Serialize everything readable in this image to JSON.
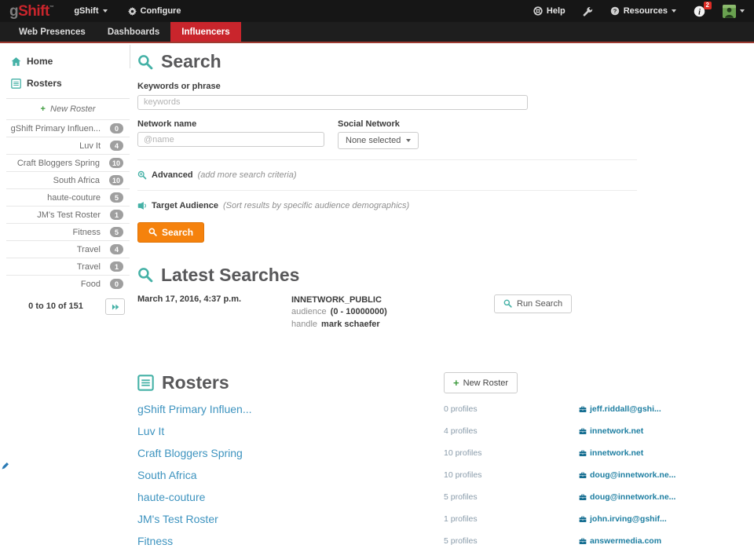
{
  "topnav": {
    "logo_g": "g",
    "logo_shift": "Shift",
    "logo_tm": "™",
    "app_menu_label": "gShift",
    "configure_label": "Configure",
    "help_label": "Help",
    "resources_label": "Resources",
    "info_badge": "2"
  },
  "tabs": [
    {
      "label": "Web Presences",
      "active": false
    },
    {
      "label": "Dashboards",
      "active": false
    },
    {
      "label": "Influencers",
      "active": true
    }
  ],
  "sidebar": {
    "home_label": "Home",
    "rosters_label": "Rosters",
    "plus": "+",
    "new_roster_label": "New Roster",
    "items": [
      {
        "label": "gShift Primary Influen...",
        "count": "0"
      },
      {
        "label": "Luv It",
        "count": "4"
      },
      {
        "label": "Craft Bloggers Spring",
        "count": "10"
      },
      {
        "label": "South Africa",
        "count": "10"
      },
      {
        "label": "haute-couture",
        "count": "5"
      },
      {
        "label": "JM's Test Roster",
        "count": "1"
      },
      {
        "label": "Fitness",
        "count": "5"
      },
      {
        "label": "Travel",
        "count": "4"
      },
      {
        "label": "Travel",
        "count": "1"
      },
      {
        "label": "Food",
        "count": "0"
      }
    ],
    "page_info": "0 to 10 of 151"
  },
  "search": {
    "title": "Search",
    "keywords_label": "Keywords or phrase",
    "keywords_placeholder": "keywords",
    "network_label": "Network name",
    "network_placeholder": "@name",
    "social_label": "Social Network",
    "social_value": "None selected",
    "advanced_label": "Advanced",
    "advanced_hint": "(add more search criteria)",
    "target_label": "Target Audience",
    "target_hint": "(Sort results by specific audience demographics)",
    "search_button": "Search"
  },
  "latest_searches": {
    "title": "Latest Searches",
    "entries": [
      {
        "date": "March 17, 2016, 4:37 p.m.",
        "name": "INNETWORK_PUBLIC",
        "audience_label": "audience",
        "audience_value": "(0 - 10000000)",
        "handle_label": "handle",
        "handle_value": "mark schaefer",
        "run_button": "Run Search"
      }
    ]
  },
  "rosters_section": {
    "title": "Rosters",
    "plus": "+",
    "new_roster_button": "New Roster",
    "rows": [
      {
        "name": "gShift Primary Influen...",
        "profiles": "0 profiles",
        "email": "jeff.riddall@gshi..."
      },
      {
        "name": "Luv It",
        "profiles": "4 profiles",
        "email": "innetwork.net"
      },
      {
        "name": "Craft Bloggers Spring",
        "profiles": "10 profiles",
        "email": "innetwork.net"
      },
      {
        "name": "South Africa",
        "profiles": "10 profiles",
        "email": "doug@innetwork.ne..."
      },
      {
        "name": "haute-couture",
        "profiles": "5 profiles",
        "email": "doug@innetwork.ne..."
      },
      {
        "name": "JM's Test Roster",
        "profiles": "1 profiles",
        "email": "john.irving@gshif..."
      },
      {
        "name": "Fitness",
        "profiles": "5 profiles",
        "email": "answermedia.com"
      }
    ]
  },
  "colors": {
    "brand_red": "#c9252c",
    "accent_teal": "#44b1a6",
    "action_orange": "#f5820d",
    "link_blue": "#3d93bf",
    "email_blue": "#1d7ea1",
    "badge_gray": "#9f9f9f",
    "notification_red": "#dd2c25"
  }
}
